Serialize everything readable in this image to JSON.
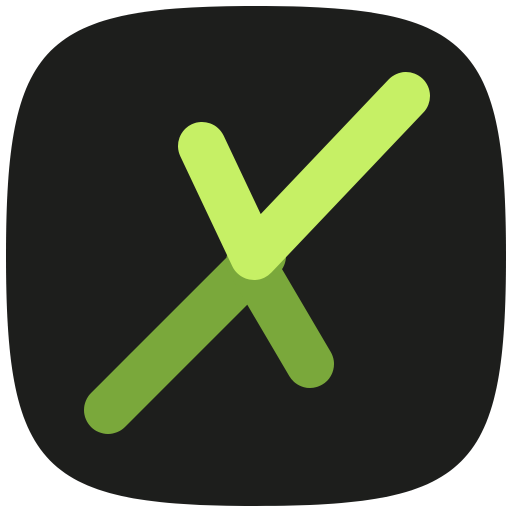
{
  "icon": {
    "name": "x-check-logo-icon",
    "colors": {
      "tile_background": "#1d1e1c",
      "stroke_light": "#c6f065",
      "stroke_dark": "#7aa83b"
    }
  }
}
